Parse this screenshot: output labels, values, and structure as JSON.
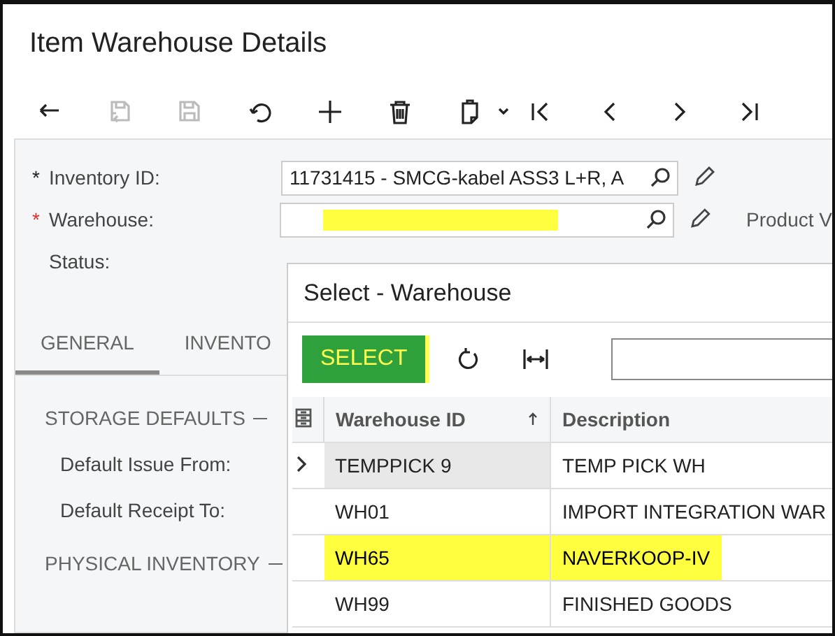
{
  "window": {
    "title": "Item Warehouse Details"
  },
  "toolbar": [
    {
      "kind": "back",
      "disabled": false
    },
    {
      "kind": "save-close",
      "disabled": true
    },
    {
      "kind": "save",
      "disabled": true
    },
    {
      "kind": "undo",
      "disabled": false
    },
    {
      "kind": "add",
      "disabled": false
    },
    {
      "kind": "delete",
      "disabled": false
    },
    {
      "kind": "clipboard",
      "disabled": false
    },
    {
      "kind": "first",
      "disabled": false
    },
    {
      "kind": "prev",
      "disabled": false
    },
    {
      "kind": "next",
      "disabled": false
    },
    {
      "kind": "last",
      "disabled": false
    }
  ],
  "form": {
    "fields": [
      {
        "kind": "lookup",
        "label": "Inventory ID:",
        "required_mark": "*",
        "error": false,
        "value": "11731415 - SMCG-kabel ASS3 L+R, A"
      },
      {
        "kind": "lookup",
        "label": "Warehouse:",
        "required_mark": "*",
        "error": true,
        "highlighted": true,
        "side_label": "Product V"
      },
      {
        "kind": "text",
        "label": "Status:"
      }
    ]
  },
  "tabs": [
    {
      "label": "GENERAL",
      "selected": true
    },
    {
      "label": "INVENTO",
      "selected": false
    }
  ],
  "sections": [
    {
      "title": "STORAGE DEFAULTS",
      "fields": [
        "Default Issue From:",
        "Default Receipt To:"
      ]
    },
    {
      "title": "PHYSICAL INVENTORY"
    }
  ],
  "dialog": {
    "title": "Select - Warehouse",
    "select_button": "SELECT",
    "table": {
      "columns": [
        {
          "label": "Warehouse ID",
          "sorted": true
        },
        {
          "label": "Description",
          "sorted": false
        }
      ],
      "rows": [
        {
          "cells": [
            "TEMPPICK 9",
            "TEMP PICK WH"
          ],
          "current": true,
          "highlighted": false
        },
        {
          "cells": [
            "WH01",
            "IMPORT INTEGRATION WAR"
          ],
          "current": false,
          "highlighted": false
        },
        {
          "cells": [
            "WH65",
            "NAVERKOOP-IV"
          ],
          "current": false,
          "highlighted": true
        },
        {
          "cells": [
            "WH99",
            "FINISHED GOODS"
          ],
          "current": false,
          "highlighted": false
        }
      ]
    }
  }
}
